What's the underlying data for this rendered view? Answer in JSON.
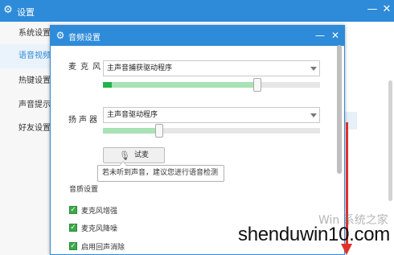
{
  "outer_window": {
    "title": "设置",
    "icons": {
      "app": "gear-icon",
      "minimize": "minimize-icon",
      "close": "close-icon"
    },
    "sidebar": {
      "items": [
        {
          "label": "系统设置",
          "active": false
        },
        {
          "label": "语音视频",
          "active": true
        },
        {
          "label": "热键设置",
          "active": false
        },
        {
          "label": "声音提示",
          "active": false
        },
        {
          "label": "好友设置",
          "active": false
        }
      ]
    }
  },
  "dialog": {
    "title": "音频设置",
    "icons": {
      "app": "gear-icon",
      "minimize": "minimize-icon",
      "close": "close-icon"
    },
    "microphone": {
      "label": "麦克风",
      "device": "主声音捕获驱动程序",
      "volume_percent": 71
    },
    "speaker": {
      "label": "扬声器",
      "device": "主声音驱动程序",
      "volume_percent": 26
    },
    "test_button": {
      "label": "试麦",
      "icon": "microphone-icon"
    },
    "tooltip": "若未听到声音，建议您进行语音检测",
    "quality": {
      "heading": "音质设置",
      "options": [
        {
          "label": "麦克风增强",
          "checked": true
        },
        {
          "label": "麦克风降噪",
          "checked": true
        },
        {
          "label": "启用回声消除",
          "checked": true
        }
      ]
    }
  },
  "watermark": {
    "faint": "Win 系统之家",
    "main": "shenduwin10.com"
  },
  "colors": {
    "titlebar": "#2e8bd9",
    "slider_fill": "#a8e2b5",
    "checkbox": "#3aaa4a",
    "arrow": "#e0302c"
  }
}
